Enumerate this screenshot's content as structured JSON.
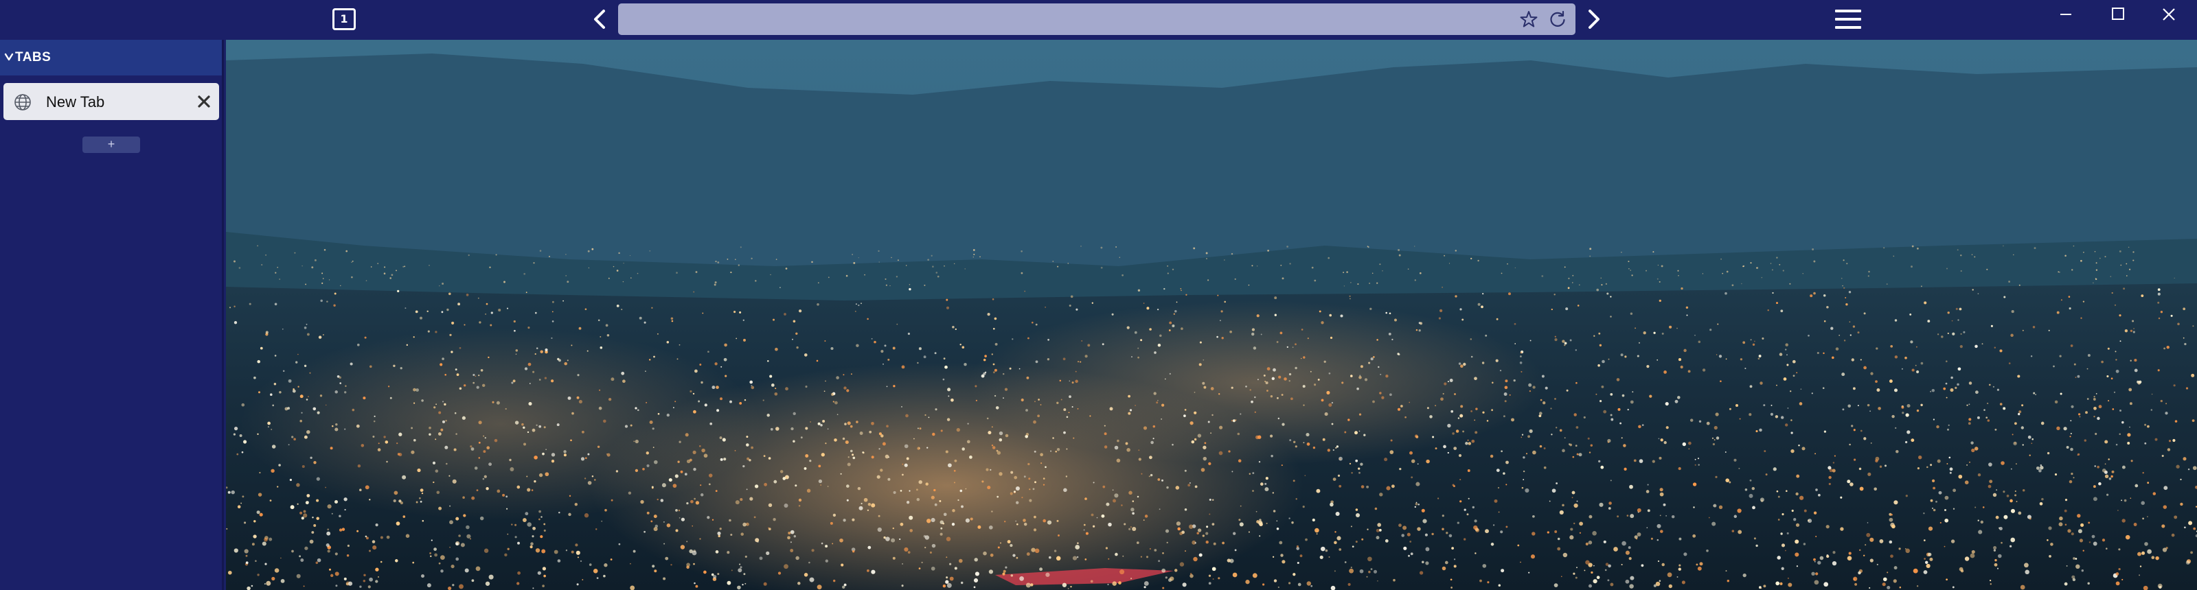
{
  "window": {
    "tab_count": "1",
    "minimize_icon": "minimize-icon",
    "maximize_icon": "maximize-icon",
    "close_icon": "close-icon"
  },
  "toolbar": {
    "url_value": "",
    "url_placeholder": "",
    "bookmark_icon": "star-icon",
    "reload_icon": "reload-icon",
    "back_icon": "chevron-left-icon",
    "forward_icon": "chevron-right-icon",
    "menu_icon": "hamburger-menu-icon"
  },
  "sidebar": {
    "header_label": "TABS",
    "tabs": [
      {
        "title": "New Tab",
        "icon": "globe-icon",
        "active": true
      }
    ],
    "new_tab_label": "+"
  },
  "content": {
    "background": "city-lights-night-panorama",
    "colors": {
      "sky": "#2d5a73",
      "mountains": "#25495f",
      "city_dark": "#132433",
      "lights": "#ffb060"
    }
  },
  "colors": {
    "chrome": "#1b2068",
    "url_bar": "#a4a9cd",
    "sidebar_header": "#233886",
    "active_tab": "#e8e9ef"
  }
}
